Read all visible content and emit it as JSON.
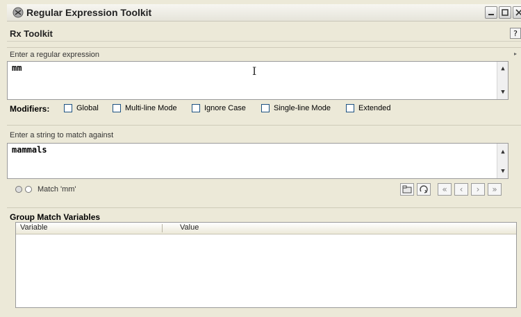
{
  "window": {
    "title": "Regular Expression Toolkit"
  },
  "toolbar": {
    "title": "Rx Toolkit",
    "help": "?"
  },
  "regex_section": {
    "label": "Enter a regular expression",
    "value": "mm"
  },
  "modifiers": {
    "label": "Modifiers:",
    "items": [
      "Global",
      "Multi-line Mode",
      "Ignore Case",
      "Single-line Mode",
      "Extended"
    ]
  },
  "string_section": {
    "label": "Enter a string to match against",
    "value": "mammals"
  },
  "status": {
    "match_text": "Match 'mm'"
  },
  "nav_buttons": [
    "«",
    "‹",
    "›",
    "»"
  ],
  "group_section": {
    "title": "Group Match Variables",
    "columns": [
      "Variable",
      "Value"
    ],
    "rows": []
  }
}
